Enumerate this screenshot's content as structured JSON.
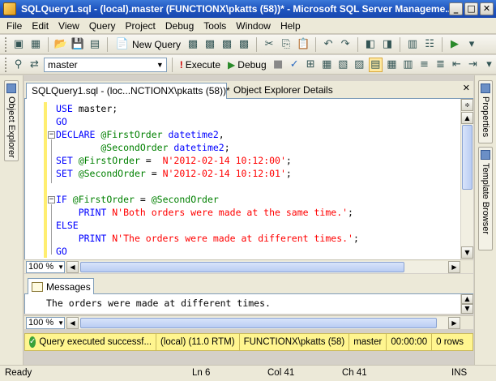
{
  "window": {
    "title": "SQLQuery1.sql - (local).master (FUNCTIONX\\pkatts (58))* - Microsoft SQL Server Manageme..."
  },
  "menu": [
    "File",
    "Edit",
    "View",
    "Query",
    "Project",
    "Debug",
    "Tools",
    "Window",
    "Help"
  ],
  "toolbar1": {
    "new_query_label": "New Query"
  },
  "toolbar2": {
    "database": "master",
    "execute_label": "Execute",
    "debug_label": "Debug"
  },
  "side_left": {
    "object_explorer": "Object Explorer"
  },
  "side_right": {
    "properties": "Properties",
    "template_browser": "Template Browser"
  },
  "tabs": {
    "active": "SQLQuery1.sql - (loc...NCTIONX\\pkatts (58))*",
    "inactive": "Object Explorer Details"
  },
  "editor": {
    "lines": [
      [
        {
          "t": "USE ",
          "c": "kw"
        },
        {
          "t": "master",
          "c": "plain"
        },
        {
          "t": ";",
          "c": "plain"
        }
      ],
      [
        {
          "t": "GO",
          "c": "kw"
        }
      ],
      [
        {
          "t": "DECLARE ",
          "c": "kw"
        },
        {
          "t": "@FirstOrder ",
          "c": "var"
        },
        {
          "t": "datetime2",
          "c": "kw"
        },
        {
          "t": ",",
          "c": "plain"
        }
      ],
      [
        {
          "t": "        @SecondOrder ",
          "c": "var"
        },
        {
          "t": "datetime2",
          "c": "kw"
        },
        {
          "t": ";",
          "c": "plain"
        }
      ],
      [
        {
          "t": "SET ",
          "c": "kw"
        },
        {
          "t": "@FirstOrder",
          "c": "var"
        },
        {
          "t": " =  ",
          "c": "plain"
        },
        {
          "t": "N'2012-02-14 10:12:00'",
          "c": "str"
        },
        {
          "t": ";",
          "c": "plain"
        }
      ],
      [
        {
          "t": "SET ",
          "c": "kw"
        },
        {
          "t": "@SecondOrder",
          "c": "var"
        },
        {
          "t": " = ",
          "c": "plain"
        },
        {
          "t": "N'2012-02-14 10:12:01'",
          "c": "str"
        },
        {
          "t": ";",
          "c": "plain"
        }
      ],
      [
        {
          "t": "",
          "c": "plain"
        }
      ],
      [
        {
          "t": "IF ",
          "c": "kw"
        },
        {
          "t": "@FirstOrder",
          "c": "var"
        },
        {
          "t": " = ",
          "c": "plain"
        },
        {
          "t": "@SecondOrder",
          "c": "var"
        }
      ],
      [
        {
          "t": "    PRINT ",
          "c": "kw"
        },
        {
          "t": "N'Both orders were made at the same time.'",
          "c": "str"
        },
        {
          "t": ";",
          "c": "plain"
        }
      ],
      [
        {
          "t": "ELSE",
          "c": "kw"
        }
      ],
      [
        {
          "t": "    PRINT ",
          "c": "kw"
        },
        {
          "t": "N'The orders were made at different times.'",
          "c": "str"
        },
        {
          "t": ";",
          "c": "plain"
        }
      ],
      [
        {
          "t": "GO",
          "c": "kw"
        }
      ]
    ],
    "zoom": "100 %"
  },
  "results": {
    "tab_label": "Messages",
    "message": "The orders were made at different times.",
    "zoom": "100 %"
  },
  "query_status": {
    "status": "Query executed successf...",
    "server": "(local) (11.0 RTM)",
    "user": "FUNCTIONX\\pkatts (58)",
    "database": "master",
    "elapsed": "00:00:00",
    "rows": "0 rows"
  },
  "statusbar": {
    "ready": "Ready",
    "ln": "Ln 6",
    "col": "Col 41",
    "ch": "Ch 41",
    "mode": "INS"
  },
  "colors": {
    "keyword": "#0000ff",
    "variable": "#008000",
    "string": "#ff0000",
    "status_bg": "#fff58f",
    "titlebar": "#1f55c0"
  }
}
